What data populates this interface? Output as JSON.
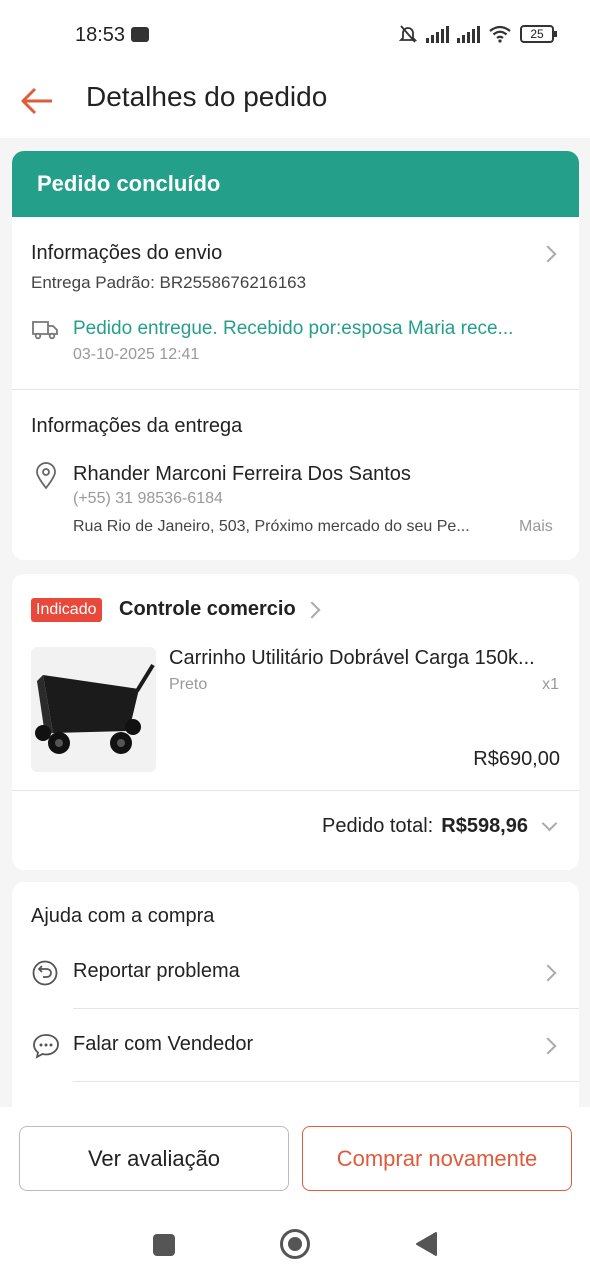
{
  "status_bar": {
    "time": "18:53",
    "battery": "25"
  },
  "header": {
    "title": "Detalhes do pedido"
  },
  "order_status": {
    "label": "Pedido concluído"
  },
  "shipping": {
    "title": "Informações do envio",
    "tracking": "Entrega Padrão: BR2558676216163",
    "update": "Pedido entregue. Recebido por:esposa Maria rece...",
    "update_time": "03-10-2025 12:41"
  },
  "delivery": {
    "title": "Informações da entrega",
    "name": "Rhander Marconi Ferreira Dos Santos",
    "phone": "(+55) 31 98536-6184",
    "address": "Rua Rio de Janeiro, 503, Próximo mercado do seu Pe...",
    "more": "Mais"
  },
  "store": {
    "badge": "Indicado",
    "name": "Controle comercio"
  },
  "product": {
    "name": "Carrinho Utilitário Dobrável Carga 150k...",
    "variant": "Preto",
    "qty": "x1",
    "price": "R$690,00"
  },
  "total": {
    "label": "Pedido total:",
    "value": "R$598,96"
  },
  "help": {
    "title": "Ajuda com a compra",
    "items": [
      {
        "label": "Reportar problema",
        "icon": "report-icon"
      },
      {
        "label": "Falar com Vendedor",
        "icon": "chat-icon"
      }
    ]
  },
  "actions": {
    "review": "Ver avaliação",
    "buy_again": "Comprar novamente"
  },
  "colors": {
    "accent": "#24a08a",
    "brand": "#e05a3c",
    "badge": "#e8493a"
  }
}
